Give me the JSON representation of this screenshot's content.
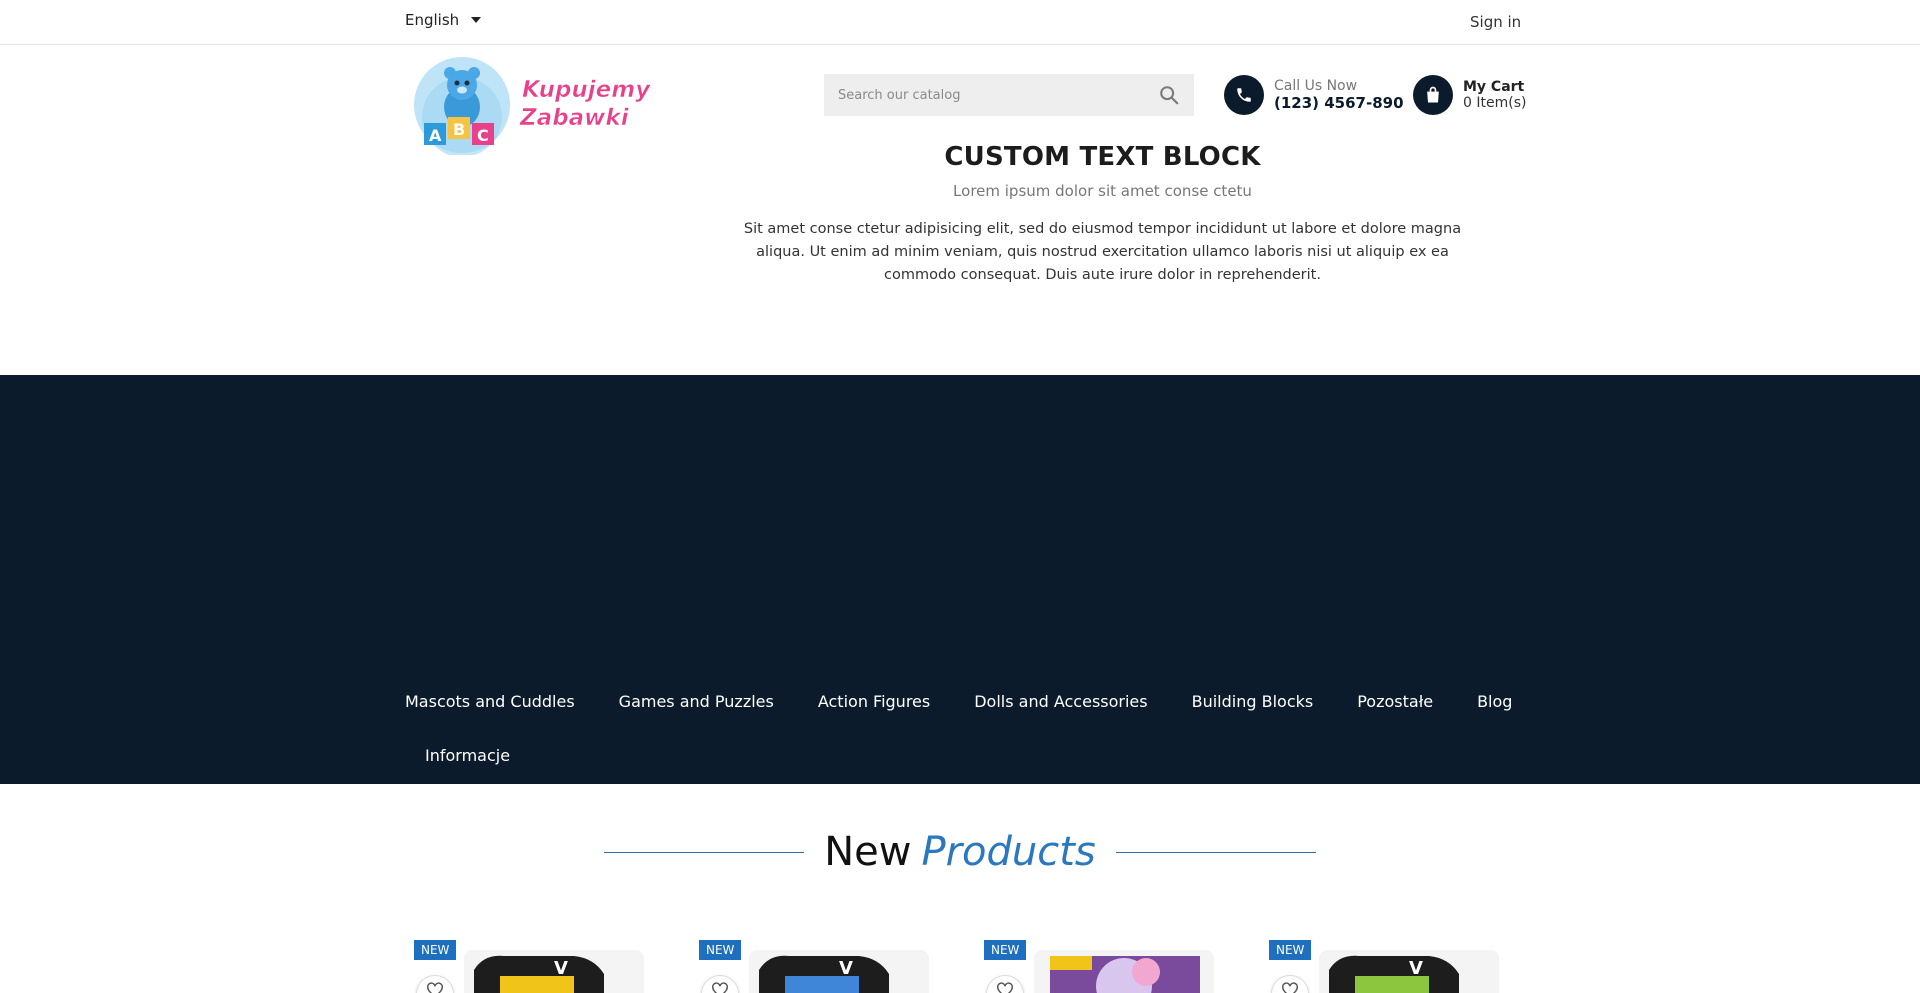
{
  "topbar": {
    "language": "English",
    "sign_in": "Sign in"
  },
  "header": {
    "logo_text_line1": "Kupujemy",
    "logo_text_line2": "Zabawki",
    "search": {
      "placeholder": "Search our catalog"
    },
    "call": {
      "label": "Call Us Now",
      "phone": "(123) 4567-890"
    },
    "cart": {
      "label": "My Cart",
      "count": "0 Item(s)"
    }
  },
  "custom_text_block": {
    "title": "CUSTOM TEXT BLOCK",
    "subtitle": "Lorem ipsum dolor sit amet conse ctetu",
    "body": "Sit amet conse ctetur adipisicing elit, sed do eiusmod tempor incididunt ut labore et dolore magna aliqua. Ut enim ad minim veniam, quis nostrud exercitation ullamco laboris nisi ut aliquip ex ea commodo consequat. Duis aute irure dolor in reprehenderit."
  },
  "nav": {
    "items": [
      {
        "label": "Mascots and Cuddles"
      },
      {
        "label": "Games and Puzzles"
      },
      {
        "label": "Action Figures"
      },
      {
        "label": "Dolls and Accessories"
      },
      {
        "label": "Building Blocks"
      },
      {
        "label": "Pozostałe"
      },
      {
        "label": "Blog"
      },
      {
        "label": "Informacje"
      }
    ]
  },
  "new_products": {
    "title_part1": "New",
    "title_part2": "Products",
    "badge": "NEW",
    "cards": [
      {
        "badge": "NEW"
      },
      {
        "badge": "NEW"
      },
      {
        "badge": "NEW"
      },
      {
        "badge": "NEW"
      }
    ]
  },
  "colors": {
    "dark_navy": "#0b1b2b",
    "accent_blue": "#2a78c0",
    "badge_blue": "#1e6fbf",
    "logo_pink": "#e8418a"
  }
}
